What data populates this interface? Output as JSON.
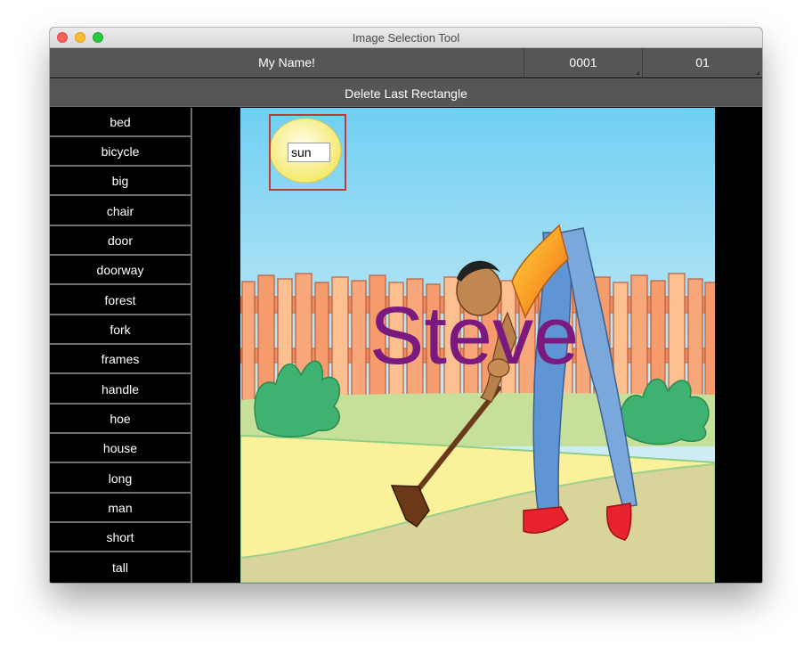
{
  "window": {
    "title": "Image Selection Tool"
  },
  "header": {
    "name": "My Name!",
    "field1": "0001",
    "field2": "01"
  },
  "actions": {
    "delete_label": "Delete Last Rectangle"
  },
  "words": [
    "bed",
    "bicycle",
    "big",
    "chair",
    "door",
    "doorway",
    "forest",
    "fork",
    "frames",
    "handle",
    "hoe",
    "house",
    "long",
    "man",
    "short",
    "tall"
  ],
  "canvas": {
    "overlay_text": "Steve",
    "selection_label": "sun"
  },
  "colors": {
    "overlay_text": "#7a1a7e",
    "selection_border": "#c0393b",
    "toolbar": "#565656"
  }
}
